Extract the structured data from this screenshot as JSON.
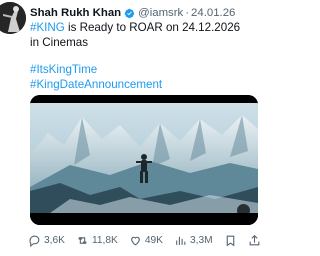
{
  "tweet": {
    "author_name": "Shah Rukh Khan",
    "handle": "@iamsrk",
    "separator": "·",
    "date": "24.01.26",
    "line1_hashtag": "#KING",
    "line1_text": " is Ready to ROAR on 24.12.2026 in Cinemas",
    "hashtag1": "#ItsKingTime",
    "hashtag2": "#KingDateAnnouncement",
    "verified_color": "#1d9bf0",
    "hashtag_color": "#1d9bf0"
  },
  "media": {
    "type": "video",
    "description_icon": "video-thumbnail"
  },
  "actions": {
    "replies": "3,6K",
    "reposts": "11,8K",
    "likes": "49K",
    "views": "3,3M",
    "icons": [
      "reply-icon",
      "repost-icon",
      "like-icon",
      "views-icon",
      "bookmark-icon",
      "share-icon"
    ]
  }
}
